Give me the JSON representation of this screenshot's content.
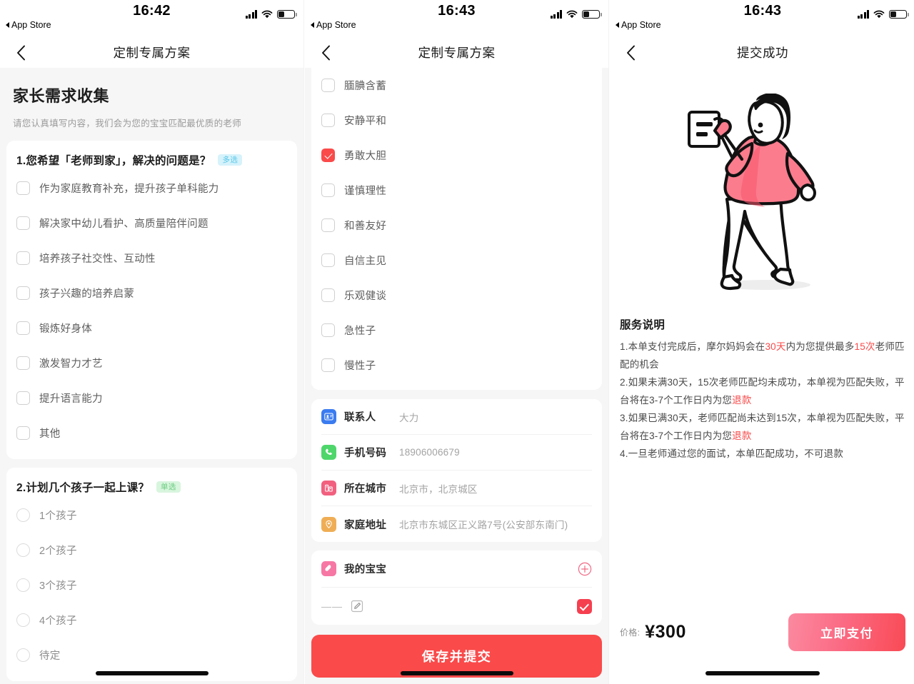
{
  "panels": [
    {
      "status": {
        "time": "16:42",
        "back_app": "App Store",
        "signal_icon": "cellular-signal-icon",
        "wifi_icon": "wifi-icon",
        "battery_icon": "battery-icon"
      },
      "nav": {
        "back_icon": "chevron-left-icon",
        "title": "定制专属方案"
      },
      "hero": {
        "title": "家长需求收集",
        "subtitle": "请您认真填写内容，我们会为您的宝宝匹配最优质的老师"
      },
      "questions": [
        {
          "title": "1.您希望「老师到家」，解决的问题是？",
          "badge": "多选",
          "badge_type": "multi",
          "type": "checkbox",
          "options": [
            {
              "label": "作为家庭教育补充，提升孩子单科能力",
              "checked": false
            },
            {
              "label": "解决家中幼儿看护、高质量陪伴问题",
              "checked": false
            },
            {
              "label": "培养孩子社交性、互动性",
              "checked": false
            },
            {
              "label": "孩子兴趣的培养启蒙",
              "checked": false
            },
            {
              "label": "锻炼好身体",
              "checked": false
            },
            {
              "label": "激发智力才艺",
              "checked": false
            },
            {
              "label": "提升语言能力",
              "checked": false
            },
            {
              "label": "其他",
              "checked": false
            }
          ]
        },
        {
          "title": "2.计划几个孩子一起上课？",
          "badge": "单选",
          "badge_type": "single",
          "type": "radio",
          "options": [
            {
              "label": "1个孩子",
              "checked": false
            },
            {
              "label": "2个孩子",
              "checked": false
            },
            {
              "label": "3个孩子",
              "checked": false
            },
            {
              "label": "4个孩子",
              "checked": false
            },
            {
              "label": "待定",
              "checked": false
            }
          ]
        }
      ]
    },
    {
      "status": {
        "time": "16:43",
        "back_app": "App Store",
        "signal_icon": "cellular-signal-icon",
        "wifi_icon": "wifi-icon",
        "battery_icon": "battery-icon"
      },
      "nav": {
        "back_icon": "chevron-left-icon",
        "title": "定制专属方案"
      },
      "personality_options": [
        {
          "label": "腼腆含蓄",
          "checked": false
        },
        {
          "label": "安静平和",
          "checked": false
        },
        {
          "label": "勇敢大胆",
          "checked": true
        },
        {
          "label": "谨慎理性",
          "checked": false
        },
        {
          "label": "和善友好",
          "checked": false
        },
        {
          "label": "自信主见",
          "checked": false
        },
        {
          "label": "乐观健谈",
          "checked": false
        },
        {
          "label": "急性子",
          "checked": false
        },
        {
          "label": "慢性子",
          "checked": false
        }
      ],
      "info_rows": [
        {
          "icon": "contact-card-icon",
          "label": "联系人",
          "value": "大力"
        },
        {
          "icon": "phone-icon",
          "label": "手机号码",
          "value": "18906006679"
        },
        {
          "icon": "city-building-icon",
          "label": "所在城市",
          "value": "北京市，北京城区"
        },
        {
          "icon": "location-pin-icon",
          "label": "家庭地址",
          "value": "北京市东城区正义路7号(公安部东南门)"
        }
      ],
      "baby": {
        "icon": "baby-bottle-icon",
        "title": "我的宝宝",
        "add_icon": "plus-circle-icon",
        "row_value": "——",
        "edit_icon": "edit-pencil-icon",
        "selected": true
      },
      "submit_label": "保存并提交"
    },
    {
      "status": {
        "time": "16:43",
        "back_app": "App Store",
        "signal_icon": "cellular-signal-icon",
        "wifi_icon": "wifi-icon",
        "battery_icon": "battery-icon"
      },
      "nav": {
        "back_icon": "chevron-left-icon",
        "title": "提交成功"
      },
      "illustration": "person-holding-document-illustration",
      "service": {
        "title": "服务说明",
        "items": [
          {
            "prefix": "1.本单支付完成后，摩尔妈妈会在",
            "hl1": "30天",
            "mid": "内为您提供最多",
            "hl2": "15次",
            "suffix": "老师匹配的机会"
          },
          {
            "prefix": "2.如果未满30天，15次老师匹配均未成功，本单视为匹配失败，平台将在3-7个工作日内为您",
            "hl1": "退款",
            "mid": "",
            "hl2": "",
            "suffix": ""
          },
          {
            "prefix": "3.如果已满30天，老师匹配尚未达到15次，本单视为匹配失败，平台将在3-7个工作日内为您",
            "hl1": "退款",
            "mid": "",
            "hl2": "",
            "suffix": ""
          },
          {
            "prefix": "4.一旦老师通过您的面试，本单匹配成功，不可退款",
            "hl1": "",
            "mid": "",
            "hl2": "",
            "suffix": ""
          }
        ]
      },
      "pay": {
        "price_label": "价格:",
        "price_value": "¥300",
        "button_label": "立即支付"
      }
    }
  ],
  "colors": {
    "accent_red": "#fa4a4a",
    "badge_multi_bg": "#d6f2fb",
    "badge_multi_fg": "#59c8e8",
    "badge_single_bg": "#d8f5dd",
    "badge_single_fg": "#6bcc81",
    "page_bg": "#f6f6f6"
  }
}
